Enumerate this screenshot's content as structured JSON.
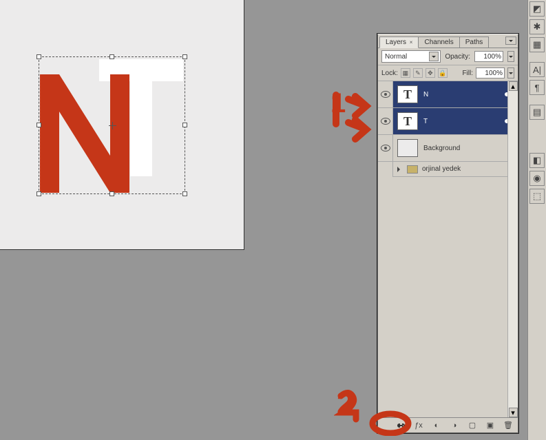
{
  "panel": {
    "tabs": {
      "layers": "Layers",
      "channels": "Channels",
      "paths": "Paths"
    },
    "blend_mode": "Normal",
    "opacity_label": "Opacity:",
    "opacity_value": "100%",
    "lock_label": "Lock:",
    "fill_label": "Fill:",
    "fill_value": "100%",
    "layers": [
      {
        "name": "N",
        "thumb": "T",
        "selected": true,
        "visible": true,
        "linked": true,
        "type": "text"
      },
      {
        "name": "T",
        "thumb": "T",
        "selected": true,
        "visible": true,
        "linked": true,
        "type": "text"
      },
      {
        "name": "Background",
        "thumb": "",
        "selected": false,
        "visible": true,
        "linked": false,
        "type": "raster"
      }
    ],
    "group": {
      "name": "orjinal yedek"
    }
  },
  "annotations": {
    "one": "1",
    "two": "2"
  },
  "colors": {
    "accent": "#c53618",
    "selection": "#2a3d72"
  }
}
